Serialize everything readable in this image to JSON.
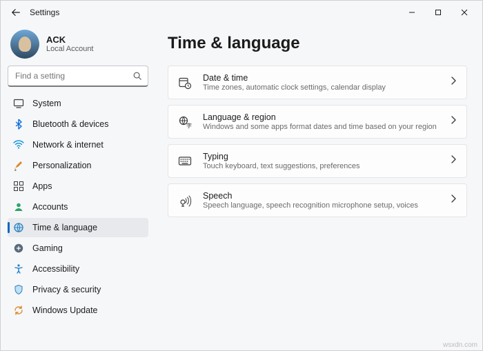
{
  "window": {
    "title": "Settings"
  },
  "profile": {
    "name": "ACK",
    "sub": "Local Account"
  },
  "search": {
    "placeholder": "Find a setting"
  },
  "sidebar": {
    "items": [
      {
        "id": "system",
        "label": "System"
      },
      {
        "id": "bluetooth",
        "label": "Bluetooth & devices"
      },
      {
        "id": "network",
        "label": "Network & internet"
      },
      {
        "id": "personalization",
        "label": "Personalization"
      },
      {
        "id": "apps",
        "label": "Apps"
      },
      {
        "id": "accounts",
        "label": "Accounts"
      },
      {
        "id": "time-language",
        "label": "Time & language",
        "active": true
      },
      {
        "id": "gaming",
        "label": "Gaming"
      },
      {
        "id": "accessibility",
        "label": "Accessibility"
      },
      {
        "id": "privacy",
        "label": "Privacy & security"
      },
      {
        "id": "windows-update",
        "label": "Windows Update"
      }
    ]
  },
  "page": {
    "title": "Time & language",
    "cards": [
      {
        "id": "date-time",
        "title": "Date & time",
        "sub": "Time zones, automatic clock settings, calendar display"
      },
      {
        "id": "language-region",
        "title": "Language & region",
        "sub": "Windows and some apps format dates and time based on your region"
      },
      {
        "id": "typing",
        "title": "Typing",
        "sub": "Touch keyboard, text suggestions, preferences"
      },
      {
        "id": "speech",
        "title": "Speech",
        "sub": "Speech language, speech recognition microphone setup, voices"
      }
    ]
  },
  "watermark": "wsxdn.com"
}
